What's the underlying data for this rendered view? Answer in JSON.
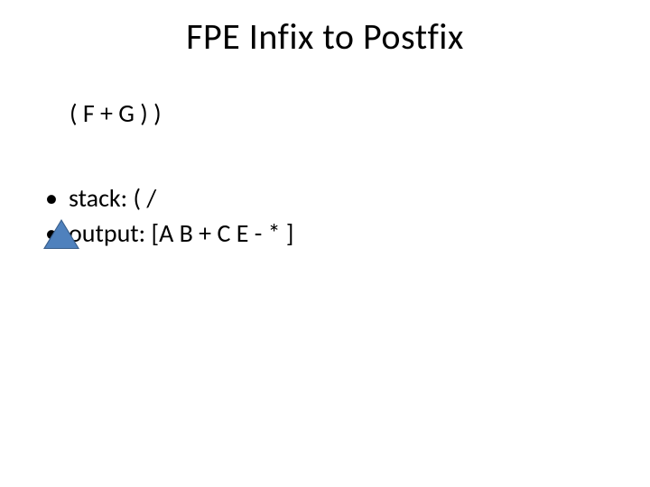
{
  "title": "FPE Infix to Postfix",
  "expression": "( F + G ) )",
  "bullets": [
    {
      "label": "stack:",
      "value": "( /"
    },
    {
      "label": "output:",
      "value": "[A B + C E - * ]"
    }
  ]
}
